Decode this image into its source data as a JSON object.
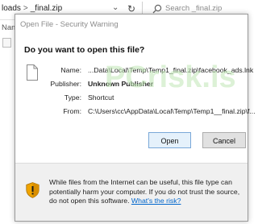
{
  "explorer": {
    "breadcrumb_prev": "loads",
    "breadcrumb_sep": ">",
    "breadcrumb_current": "_final.zip",
    "chevron": "⌄",
    "refresh_glyph": "↻",
    "search_placeholder": "Search _final.zip",
    "column_name": "Nam"
  },
  "dialog": {
    "title": "Open File - Security Warning",
    "question": "Do you want to open this file?",
    "fields": [
      {
        "label": "Name:",
        "value": "...Data\\Local\\Temp\\Temp1_final.zip\\facebook_ads.lnk"
      },
      {
        "label": "Publisher:",
        "value": "Unknown Publisher"
      },
      {
        "label": "Type:",
        "value": "Shortcut"
      },
      {
        "label": "From:",
        "value": "C:\\Users\\cc\\AppData\\Local\\Temp\\Temp1__final.zip\\f..."
      }
    ],
    "buttons": {
      "open": "Open",
      "cancel": "Cancel"
    },
    "warning_text": "While files from the Internet can be useful, this file type can potentially harm your computer. If you do not trust the source, do not open this software.",
    "warning_link": "What's the risk?"
  },
  "watermark": {
    "text": "PCrisk.is",
    "color": "#bfe5b5"
  },
  "colors": {
    "link": "#0066cc",
    "shield": "#f0a400",
    "footer_bg": "#f0f0f0"
  }
}
